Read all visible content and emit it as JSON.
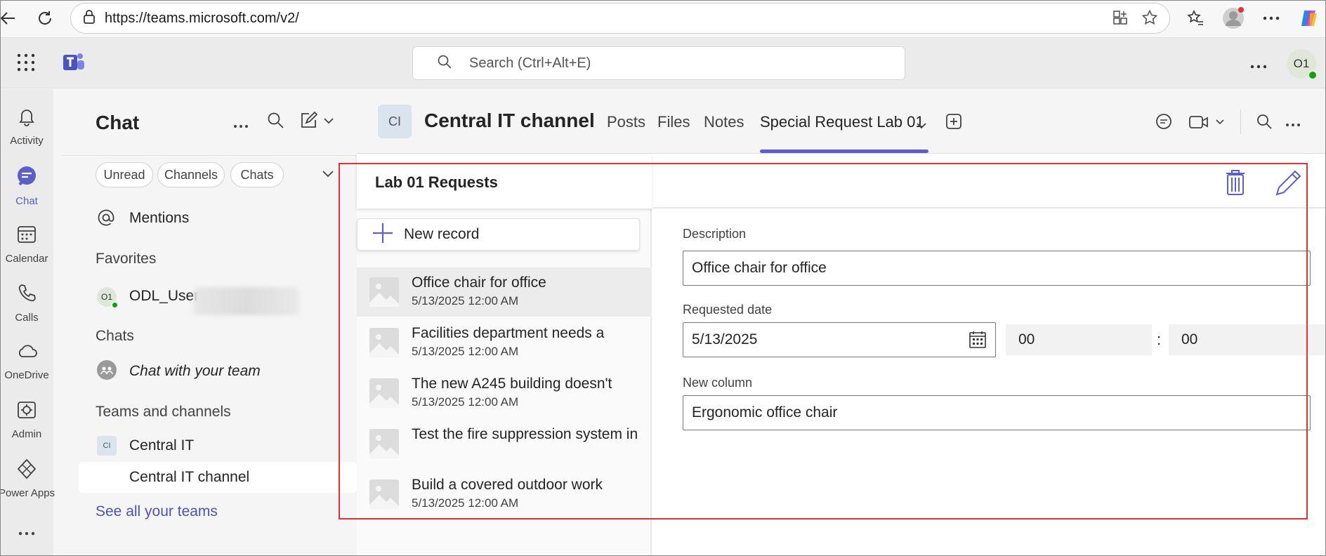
{
  "browser": {
    "url": "https://teams.microsoft.com/v2/"
  },
  "header": {
    "search_placeholder": "Search (Ctrl+Alt+E)",
    "user_initials": "O1"
  },
  "rail": {
    "items": [
      {
        "label": "Activity",
        "icon": "bell-icon"
      },
      {
        "label": "Chat",
        "icon": "chat-icon"
      },
      {
        "label": "Calendar",
        "icon": "calendar-icon"
      },
      {
        "label": "Calls",
        "icon": "phone-icon"
      },
      {
        "label": "OneDrive",
        "icon": "cloud-icon"
      },
      {
        "label": "Admin",
        "icon": "admin-gear-icon"
      },
      {
        "label": "Power Apps",
        "icon": "power-apps-icon"
      }
    ]
  },
  "chat": {
    "title": "Chat",
    "filters": [
      "Unread",
      "Channels",
      "Chats"
    ],
    "mentions": "Mentions",
    "favorites_header": "Favorites",
    "favorite_user": "ODL_User",
    "favorite_initials": "O1",
    "chats_header": "Chats",
    "chat_with_team": "Chat with your team",
    "teams_header": "Teams and channels",
    "team_name": "Central IT",
    "team_initials": "CI",
    "channel_name": "Central IT channel",
    "see_all": "See all your teams"
  },
  "channel": {
    "initials": "CI",
    "title": "Central IT channel",
    "tabs": [
      "Posts",
      "Files",
      "Notes",
      "Special Request Lab 01"
    ]
  },
  "app": {
    "list_title": "Lab 01 Requests",
    "new_record": "New record",
    "records": [
      {
        "title": "Office chair for office",
        "date": "5/13/2025 12:00 AM"
      },
      {
        "title": "Facilities department needs a",
        "date": "5/13/2025 12:00 AM"
      },
      {
        "title": "The new A245 building doesn't",
        "date": "5/13/2025 12:00 AM"
      },
      {
        "title": "Test the fire suppression system in",
        "date": ""
      },
      {
        "title": "Build a covered outdoor work",
        "date": "5/13/2025 12:00 AM"
      }
    ],
    "form": {
      "description_label": "Description",
      "description_value": "Office chair for office",
      "date_label": "Requested date",
      "date_value": "5/13/2025",
      "hour": "00",
      "minute": "00",
      "time_sep": ":",
      "newcol_label": "New column",
      "newcol_value": "Ergonomic office chair"
    }
  },
  "colors": {
    "accent": "#5b5fc7",
    "highlight": "#e0313a"
  }
}
